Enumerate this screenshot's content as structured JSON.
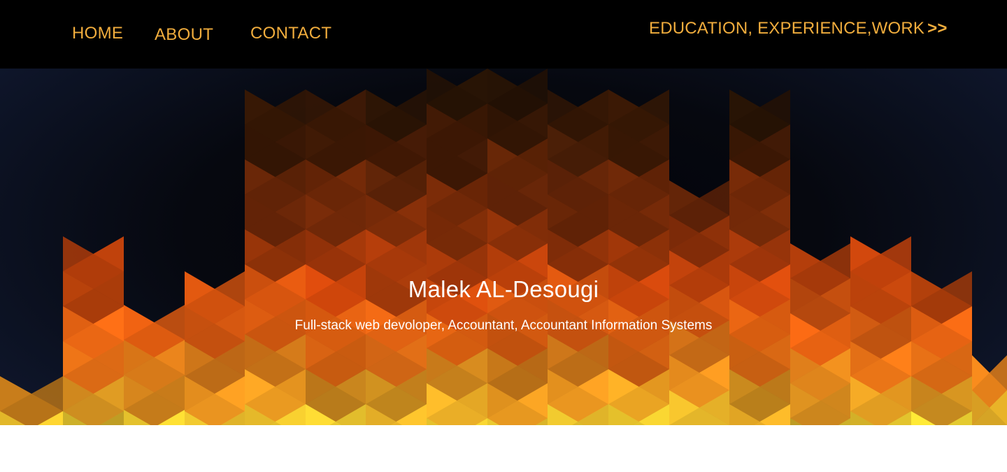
{
  "nav": {
    "home": "HOME",
    "about": "ABOUT",
    "contact": "CONTACT",
    "more": "EDUCATION, EXPERIENCE,WORK",
    "more_chevron": ">>"
  },
  "hero": {
    "name": "Malek AL-Desougi",
    "tagline": "Full-stack web devoloper, Accountant, Accountant Information Systems"
  },
  "colors": {
    "nav_text": "#f1ad3d",
    "topbar_bg": "#000000",
    "hero_bg": "#06080f",
    "accent_orange": "#ee6a12",
    "accent_yellow": "#f9d02e"
  }
}
